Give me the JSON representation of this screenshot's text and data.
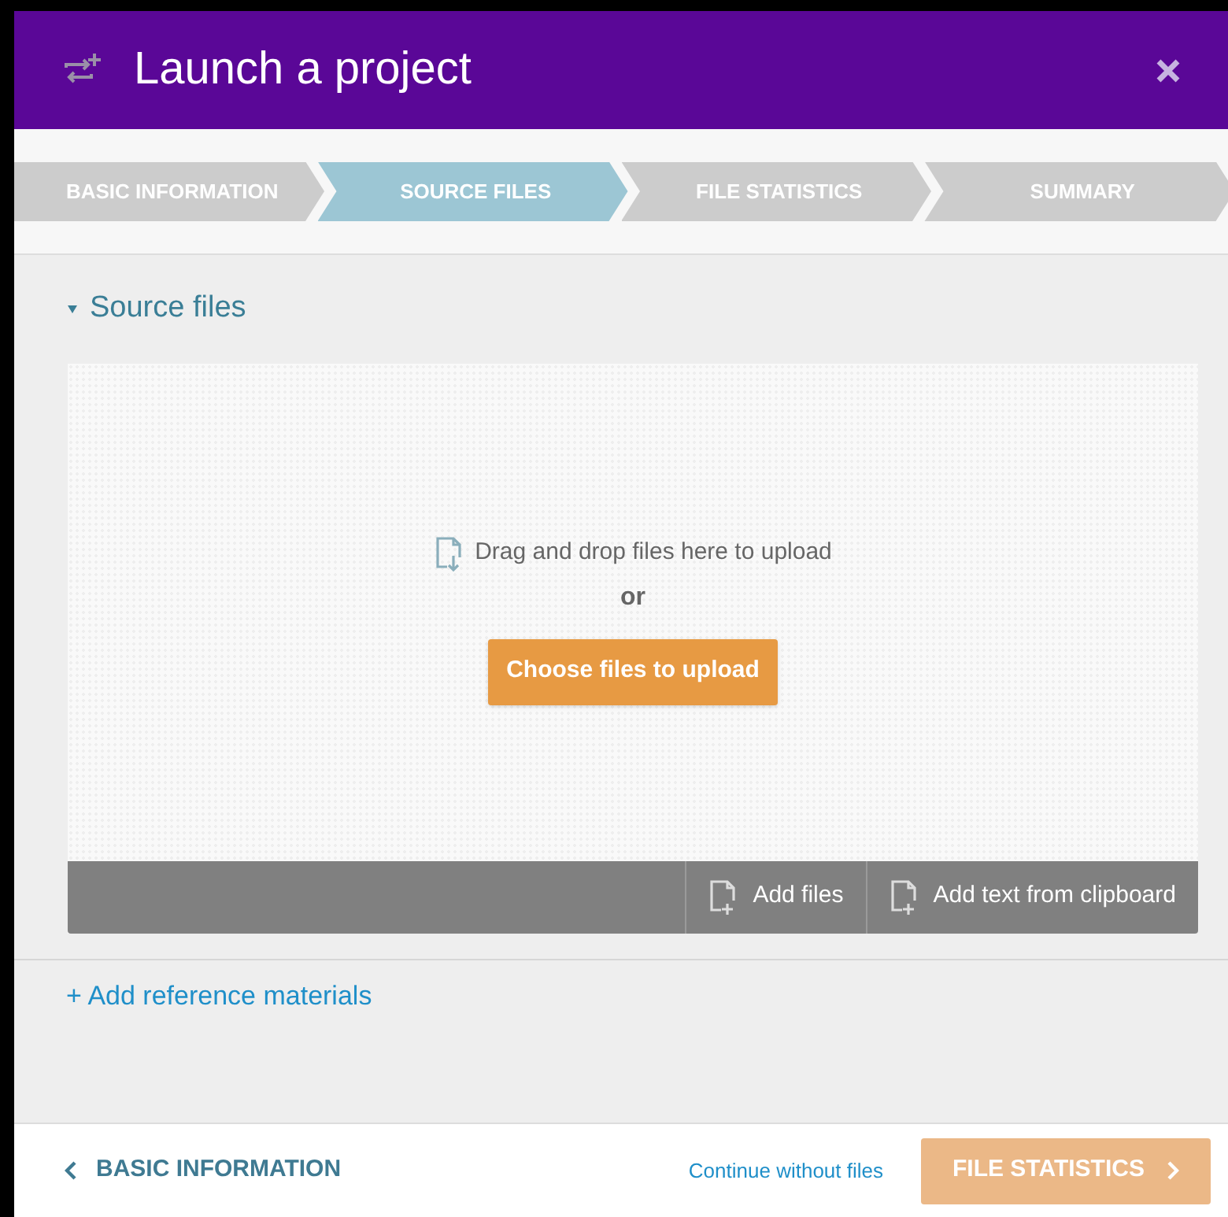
{
  "header": {
    "title": "Launch a project"
  },
  "steps": [
    {
      "label": "BASIC INFORMATION",
      "selected": false
    },
    {
      "label": "SOURCE FILES",
      "selected": true
    },
    {
      "label": "FILE STATISTICS",
      "selected": false
    },
    {
      "label": "SUMMARY",
      "selected": false
    }
  ],
  "section": {
    "title": "Source files",
    "expanded": true
  },
  "dropzone": {
    "hint": "Drag and drop files here to upload",
    "or": "or",
    "button": "Choose files to upload"
  },
  "toolbar": [
    "Add files",
    "Add text from clipboard"
  ],
  "reference_link": "+ Add reference materials",
  "footer": {
    "back": "BASIC INFORMATION",
    "skip": "Continue without files",
    "next": {
      "label": "FILE STATISTICS",
      "disabled": true
    }
  }
}
